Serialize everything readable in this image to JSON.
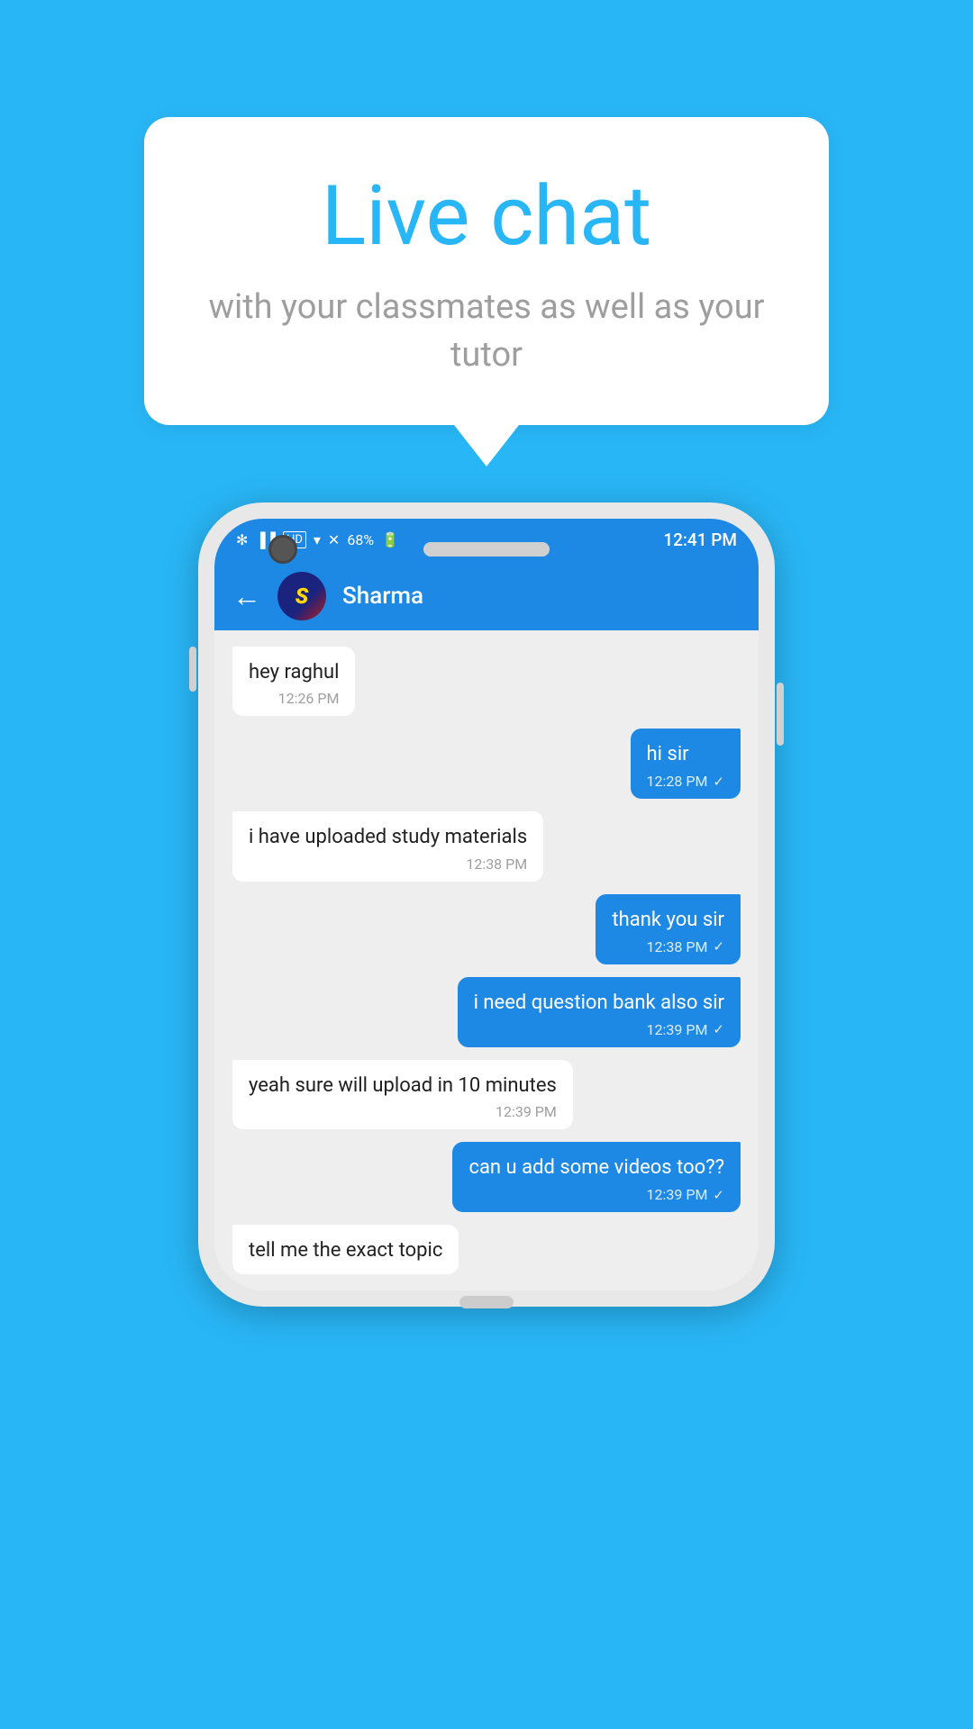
{
  "background_color": "#29b6f6",
  "bubble": {
    "title": "Live chat",
    "subtitle": "with your classmates as well as your tutor"
  },
  "phone": {
    "status_bar": {
      "time": "12:41 PM",
      "battery": "68%",
      "icons": "bluetooth wifi signal"
    },
    "chat_header": {
      "contact_name": "Sharma",
      "back_label": "←"
    },
    "messages": [
      {
        "id": 1,
        "type": "received",
        "text": "hey raghul",
        "time": "12:26 PM",
        "checkmark": false
      },
      {
        "id": 2,
        "type": "sent",
        "text": "hi sir",
        "time": "12:28 PM",
        "checkmark": true
      },
      {
        "id": 3,
        "type": "received",
        "text": "i have uploaded study materials",
        "time": "12:38 PM",
        "checkmark": false
      },
      {
        "id": 4,
        "type": "sent",
        "text": "thank you sir",
        "time": "12:38 PM",
        "checkmark": true
      },
      {
        "id": 5,
        "type": "sent",
        "text": "i need question bank also sir",
        "time": "12:39 PM",
        "checkmark": true
      },
      {
        "id": 6,
        "type": "received",
        "text": "yeah sure will upload in 10 minutes",
        "time": "12:39 PM",
        "checkmark": false
      },
      {
        "id": 7,
        "type": "sent",
        "text": "can u add some videos too??",
        "time": "12:39 PM",
        "checkmark": true
      },
      {
        "id": 8,
        "type": "received",
        "text": "tell me the exact topic",
        "time": "",
        "partial": true
      }
    ]
  }
}
